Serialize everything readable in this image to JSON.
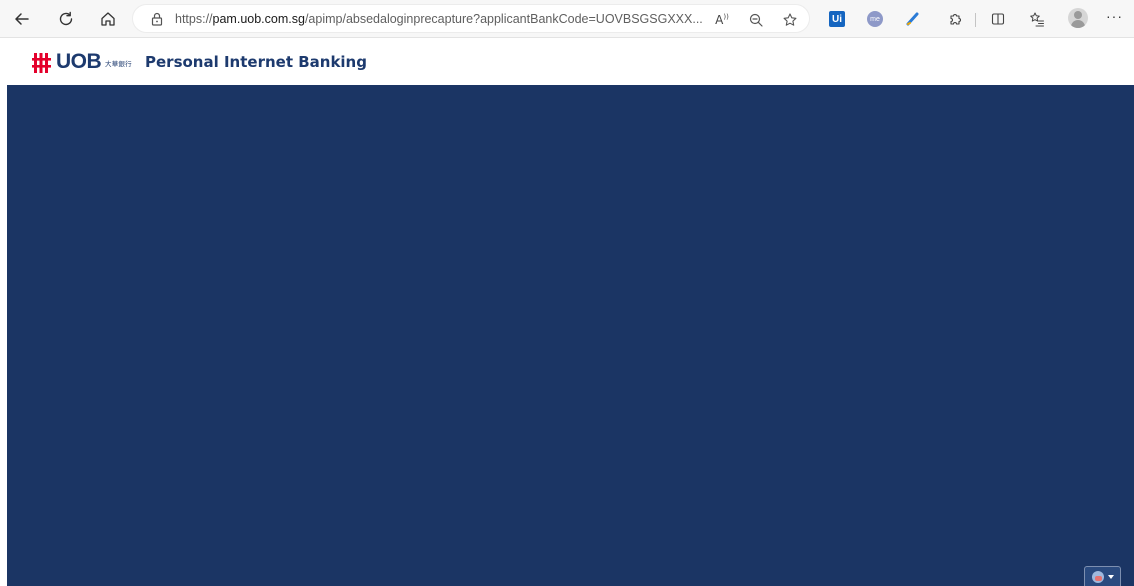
{
  "browser": {
    "url_prefix": "https://",
    "url_host": "pam.uob.com.sg",
    "url_path": "/apimp/absedaloginprecapture?applicantBankCode=UOVBSGSGXXX...",
    "read_aloud_label": "A",
    "extensions": {
      "ui_label": "Ui",
      "me_label": "me"
    },
    "more_label": "···"
  },
  "header": {
    "brand": "UOB",
    "brand_chinese": "大華銀行",
    "title": "Personal Internet Banking",
    "brand_color": "#e4002b",
    "text_color": "#1d3a6e"
  },
  "main": {
    "background_color": "#1b3564"
  },
  "icons": {
    "back": "back-arrow-icon",
    "refresh": "refresh-icon",
    "home": "home-icon",
    "lock": "lock-icon",
    "read_aloud": "read-aloud-icon",
    "zoom": "zoom-out-icon",
    "favorite": "star-icon",
    "language": "globe-icon"
  }
}
